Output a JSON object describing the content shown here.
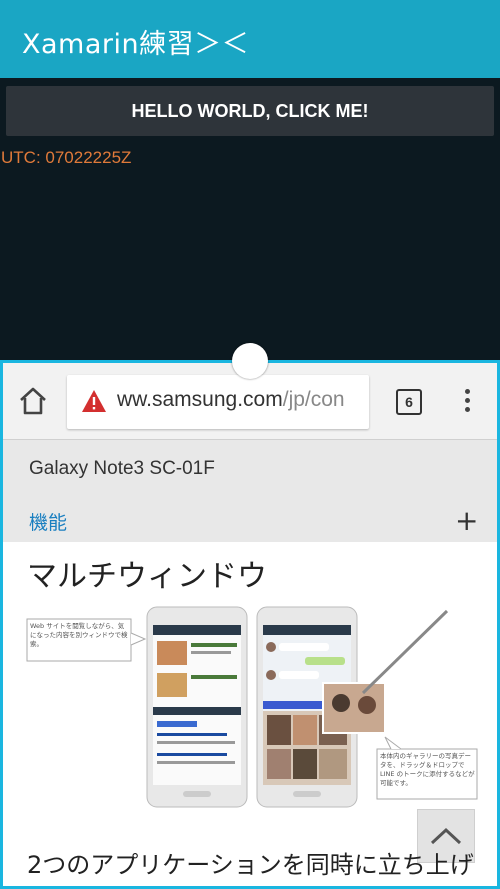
{
  "app": {
    "title": "Xamarin練習＞＜",
    "hello_button": "HELLO WORLD, CLICK ME!",
    "utc_text": "UTC: 07022225Z"
  },
  "browser": {
    "url_domain": "ww.samsung.com",
    "url_path": "/jp/con",
    "tab_count": "6",
    "product_name": "Galaxy Note3 SC-01F",
    "section_label": "機能",
    "expand_symbol": "+",
    "page_heading": "マルチウィンドウ",
    "body_text": "2つのアプリケーションを同時に立ち上げ",
    "callout_left": "Web サイトを閲覧しながら、気になった内容を別ウィンドウで検索。",
    "callout_right": "本体内のギャラリーの写真データを、ドラッグ＆ドロップで LINE のトークに添付するなどが可能です。"
  },
  "colors": {
    "app_bar": "#1aa6c4",
    "app_bg": "#0c1920",
    "utc_text": "#e07a3a",
    "window_border": "#1ab6e0",
    "link_blue": "#1a7fc0"
  }
}
